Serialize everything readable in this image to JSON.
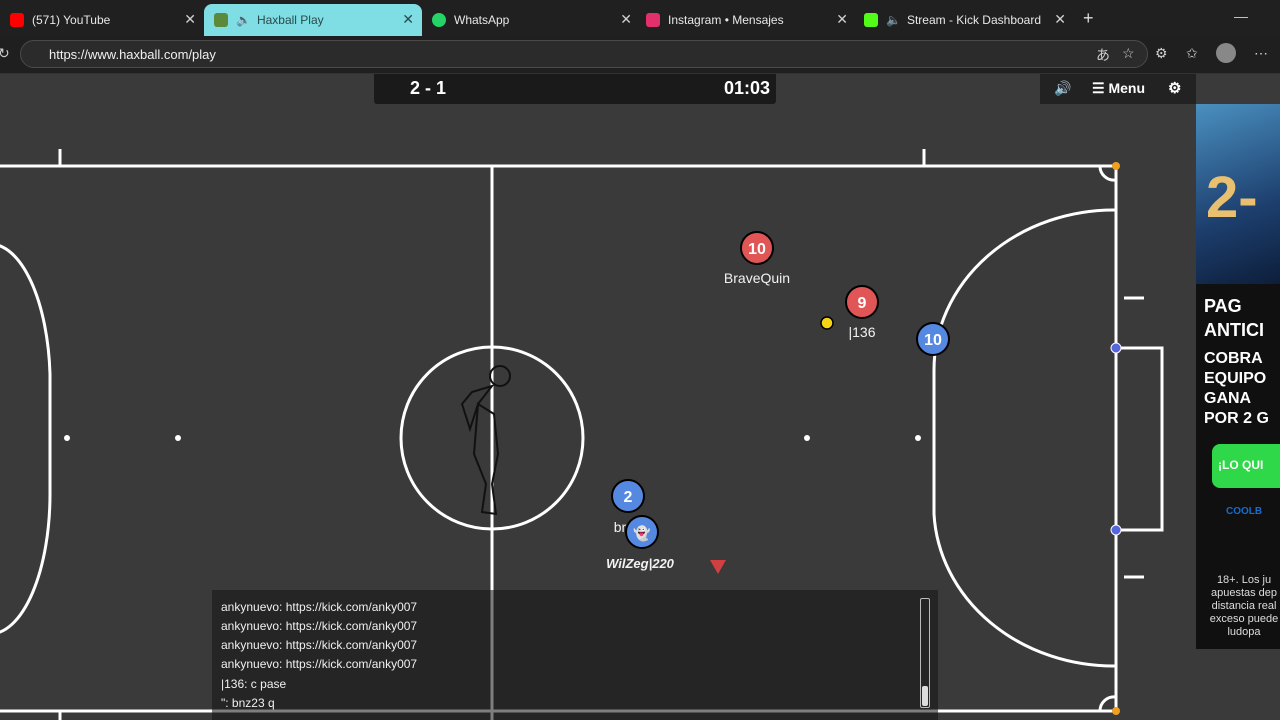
{
  "browser": {
    "tabs": [
      {
        "title": "(571) YouTube",
        "favicon_color": "#ff0000"
      },
      {
        "title": "Haxball Play",
        "favicon_color": "#5a8a3a"
      },
      {
        "title": "WhatsApp",
        "favicon_color": "#25d366"
      },
      {
        "title": "Instagram • Mensajes",
        "favicon_color": "#e1306c"
      },
      {
        "title": "Stream - Kick Dashboard",
        "favicon_color": "#53fc18"
      }
    ],
    "active_tab_index": 1,
    "url": "https://www.haxball.com/play"
  },
  "game": {
    "score": "2 - 1",
    "timer": "01:03",
    "menu_label": "Menu",
    "players": [
      {
        "number": "10",
        "name": "BraveQuin",
        "team": "red"
      },
      {
        "number": "9",
        "name": "|136",
        "team": "red"
      },
      {
        "number": "10",
        "name": "",
        "team": "blue"
      },
      {
        "number": "2",
        "name": "br",
        "team": "blue"
      },
      {
        "number": "",
        "name": "WilZeg|220",
        "team": "blue"
      }
    ],
    "colors": {
      "red": "#e05555",
      "blue": "#5588e0",
      "field": "#3a3a3a",
      "lines": "#ffffff",
      "ball": "#f5d418"
    }
  },
  "chat": {
    "lines": [
      "ankynuevo: https://kick.com/anky007",
      "ankynuevo: https://kick.com/anky007",
      "ankynuevo: https://kick.com/anky007",
      "ankynuevo: https://kick.com/anky007",
      "|136: c pase",
      "\": bnz23 q"
    ]
  },
  "ad": {
    "headline": "2-",
    "line1": "PAG",
    "line2": "ANTICI",
    "line3": "COBRA",
    "line4": "EQUIPO",
    "line5": "GANA",
    "line6": "POR 2 G",
    "button": "¡LO QUI",
    "brand": "COOLB",
    "disclaimer": "18+. Los ju apuestas dep distancia real exceso puede ludopa"
  }
}
